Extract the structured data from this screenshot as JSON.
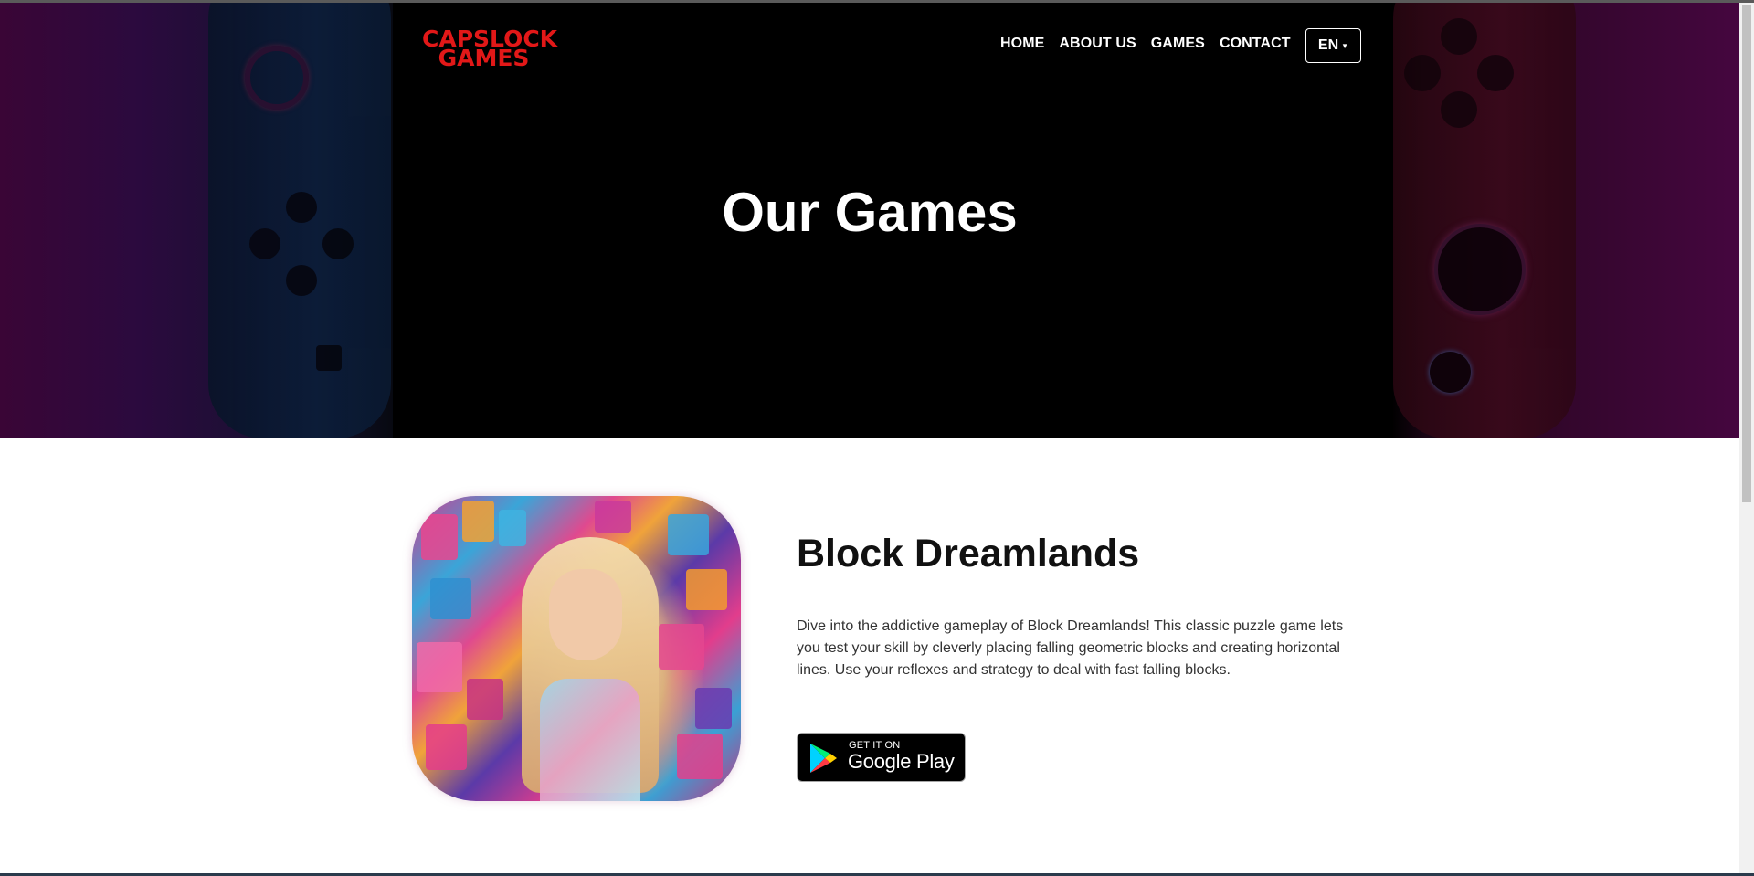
{
  "brand": {
    "line1": "CAPSLOCK",
    "line2": "GAMES",
    "color": "#e21818"
  },
  "nav": {
    "items": [
      {
        "label": "HOME"
      },
      {
        "label": "ABOUT US"
      },
      {
        "label": "GAMES"
      },
      {
        "label": "CONTACT"
      }
    ],
    "language": "EN"
  },
  "hero": {
    "title": "Our Games"
  },
  "game": {
    "title": "Block Dreamlands",
    "description": "Dive into the addictive gameplay of Block Dreamlands! This classic puzzle game lets you test your skill by cleverly placing falling geometric blocks and creating horizontal lines. Use your reflexes and strategy to deal with fast falling blocks.",
    "store_badge": {
      "small": "GET IT ON",
      "big": "Google Play"
    }
  }
}
